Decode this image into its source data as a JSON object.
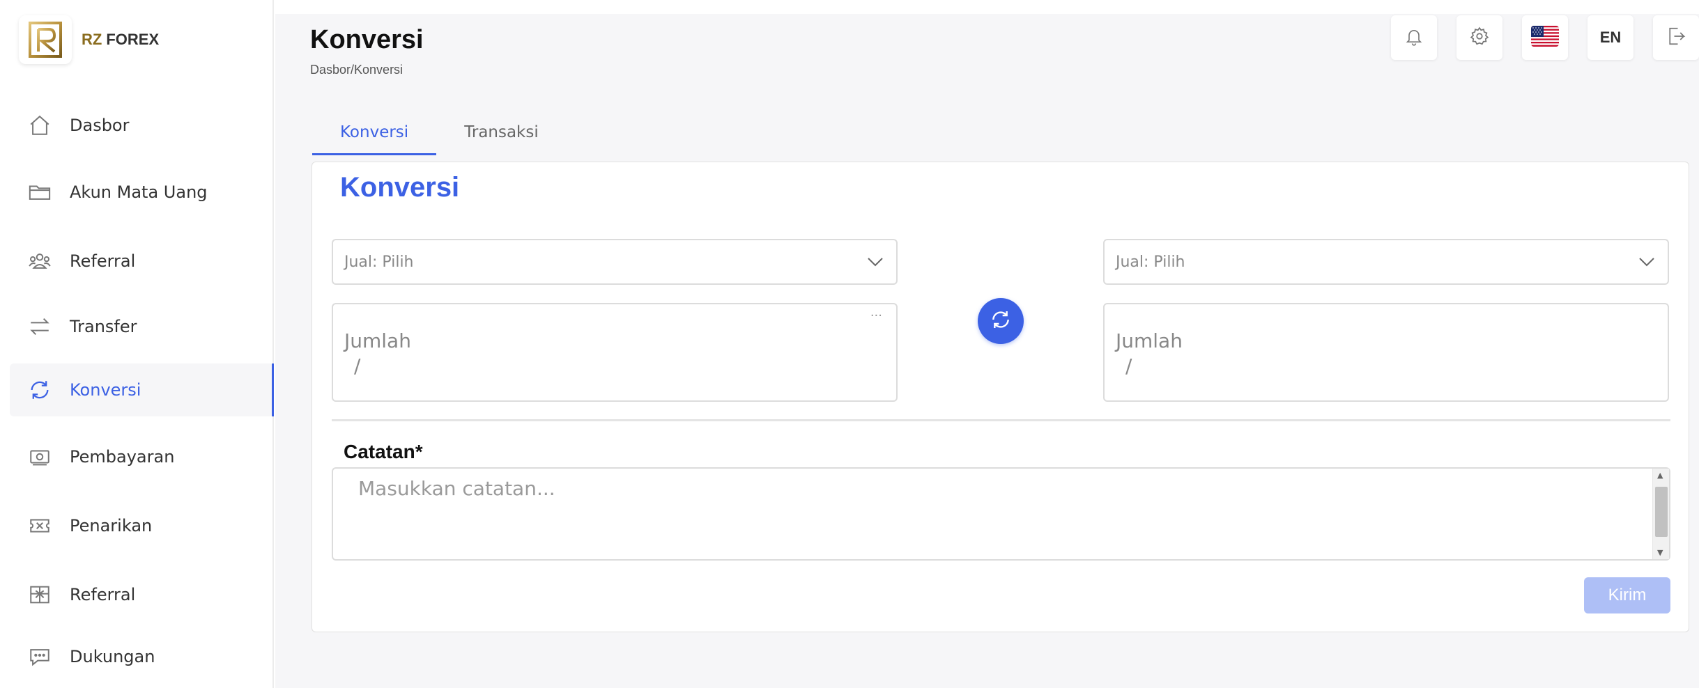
{
  "brand": {
    "prefix": "RZ",
    "name": "FOREX"
  },
  "sidebar": {
    "items": [
      {
        "label": "Dasbor",
        "icon": "home-icon"
      },
      {
        "label": "Akun Mata  Uang",
        "icon": "folder-icon"
      },
      {
        "label": "Referral",
        "icon": "users-icon"
      },
      {
        "label": "Transfer",
        "icon": "transfer-icon"
      },
      {
        "label": "Konversi",
        "icon": "refresh-icon",
        "active": true
      },
      {
        "label": "Pembayaran",
        "icon": "money-icon"
      },
      {
        "label": "Penarikan",
        "icon": "ticket-icon"
      },
      {
        "label": "Referral",
        "icon": "gift-icon"
      },
      {
        "label": "Dukungan",
        "icon": "chat-icon"
      }
    ]
  },
  "header": {
    "title": "Konversi",
    "breadcrumb": "Dasbor/Konversi",
    "language": "EN",
    "actions": [
      "bell-icon",
      "gear-icon",
      "us-flag-icon",
      "language",
      "logout-icon"
    ]
  },
  "tabs": [
    {
      "label": "Konversi",
      "active": true
    },
    {
      "label": "Transaksi",
      "active": false
    }
  ],
  "form": {
    "title": "Konversi",
    "sell_left": {
      "placeholder": "Jual:  Pilih"
    },
    "sell_right": {
      "placeholder": "Jual:  Pilih"
    },
    "amount_left": {
      "label": "Jumlah",
      "sub": "/",
      "menu": "···"
    },
    "amount_right": {
      "label": "Jumlah",
      "sub": "/"
    },
    "notes_label": "Catatan*",
    "notes_placeholder": "Masukkan catatan...",
    "submit_label": "Kirim"
  },
  "colors": {
    "accent": "#3c61e4",
    "submit_disabled": "#aebff6",
    "brand_gold": "#8a6c1e"
  }
}
